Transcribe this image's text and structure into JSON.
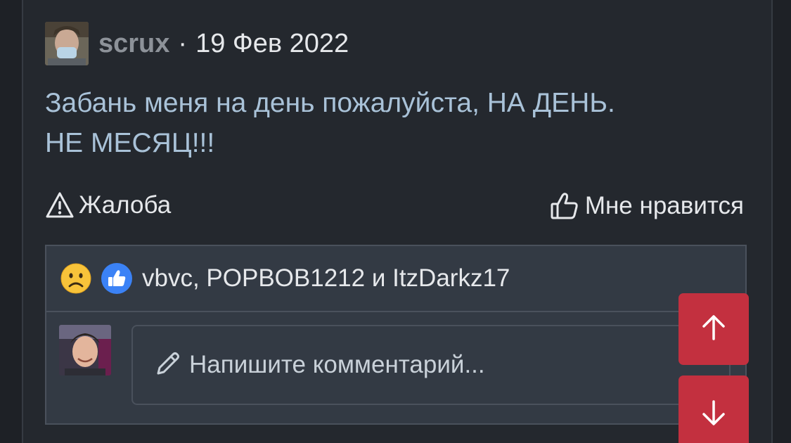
{
  "post": {
    "username": "scrux",
    "separator": "·",
    "date": "19 Фев 2022",
    "text_line1": "Забань меня на день пожалуйста, НА ДЕНЬ.",
    "text_line2": "НЕ МЕСЯЦ!!!"
  },
  "actions": {
    "report_label": "Жалоба",
    "like_label": "Мне нравится"
  },
  "reactions": {
    "icons": [
      "sad-face-icon",
      "thumbs-up-icon"
    ],
    "reactors_text": "vbvc, POPBOB1212 и ItzDarkz17"
  },
  "comment": {
    "placeholder": "Напишите комментарий..."
  },
  "scroll_buttons": {
    "up_icon": "arrow-up-icon",
    "down_icon": "arrow-down-icon"
  },
  "colors": {
    "background": "#1e2126",
    "card": "#24282e",
    "username": "#8d9299",
    "post_text": "#a9c2d8",
    "accent_red": "#c3303f",
    "like_blue": "#3b82f6"
  }
}
